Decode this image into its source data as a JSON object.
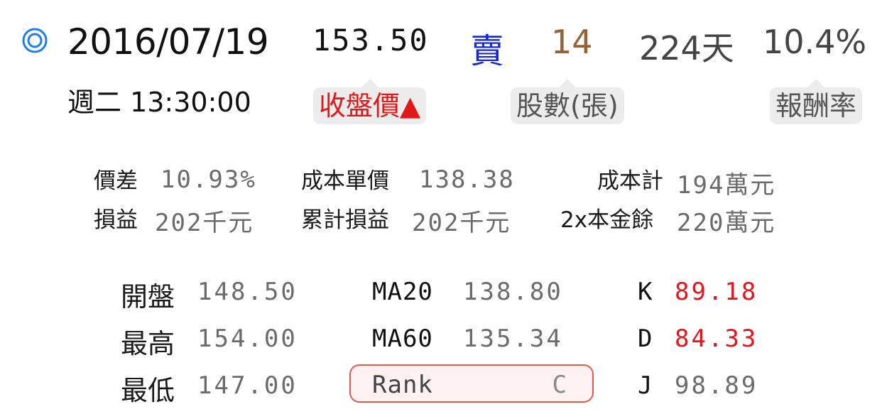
{
  "header": {
    "target_icon": "bullseye-icon",
    "date": "2016/07/19",
    "weekday_time": "週二 13:30:00",
    "price": "153.50",
    "action": "賣",
    "shares": "14",
    "days": "224天",
    "return_rate": "10.4%"
  },
  "tips": {
    "close_price": "收盤價▲",
    "shares_unit": "股數(張)",
    "return_rate": "報酬率"
  },
  "summary": {
    "price_diff_label": "價差",
    "price_diff_value": "10.93%",
    "unit_cost_label": "成本單價",
    "unit_cost_value": "138.38",
    "total_cost_label": "成本計",
    "total_cost_value": "194萬元",
    "pnl_label": "損益",
    "pnl_value": "202千元",
    "cum_pnl_label": "累計損益",
    "cum_pnl_value": "202千元",
    "principal_label": "2x本金餘",
    "principal_value": "220萬元"
  },
  "stats": {
    "open_label": "開盤",
    "open_value": "148.50",
    "high_label": "最高",
    "high_value": "154.00",
    "low_label": "最低",
    "low_value": "147.00",
    "ma20_label": "MA20",
    "ma20_value": "138.80",
    "ma60_label": "MA60",
    "ma60_value": "135.34",
    "rank_label": "Rank",
    "rank_value": "C",
    "k_label": "K",
    "k_value": "89.18",
    "d_label": "D",
    "d_value": "84.33",
    "j_label": "J",
    "j_value": "98.89"
  },
  "colors": {
    "action_sell": "#1428d8",
    "shares": "#946234",
    "close_tip": "#e01818",
    "kd_red": "#e8141b",
    "icon_blue": "#1e7ef0",
    "rank_border": "#e05a52"
  }
}
